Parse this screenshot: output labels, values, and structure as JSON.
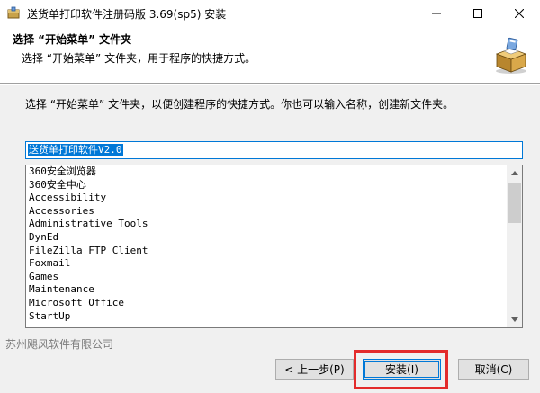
{
  "window": {
    "title": "送货单打印软件注册码版 3.69(sp5) 安装",
    "icon": "installer-icon",
    "controls": [
      "minimize-icon",
      "maximize-icon",
      "close-icon"
    ]
  },
  "header": {
    "title": "选择 “开始菜单” 文件夹",
    "subtitle": "选择 “开始菜单” 文件夹，用于程序的快捷方式。",
    "logo_icon": "package-box-icon"
  },
  "main": {
    "description": "选择 “开始菜单” 文件夹，以便创建程序的快捷方式。你也可以输入名称，创建新文件夹。",
    "folder_input": {
      "value": "送货单打印软件V2.0"
    },
    "folder_list": [
      "360安全浏览器",
      "360安全中心",
      "Accessibility",
      "Accessories",
      "Administrative Tools",
      "DynEd",
      "FileZilla FTP Client",
      "Foxmail",
      "Games",
      "Maintenance",
      "Microsoft Office",
      "StartUp"
    ]
  },
  "footer": {
    "brand": "苏州飓风软件有限公司"
  },
  "buttons": {
    "back": "< 上一步(P)",
    "install": "安装(I)",
    "cancel": "取消(C)"
  },
  "colors": {
    "accent": "#0078d7",
    "highlight": "#e32b2b",
    "panel": "#f0f0f0"
  }
}
